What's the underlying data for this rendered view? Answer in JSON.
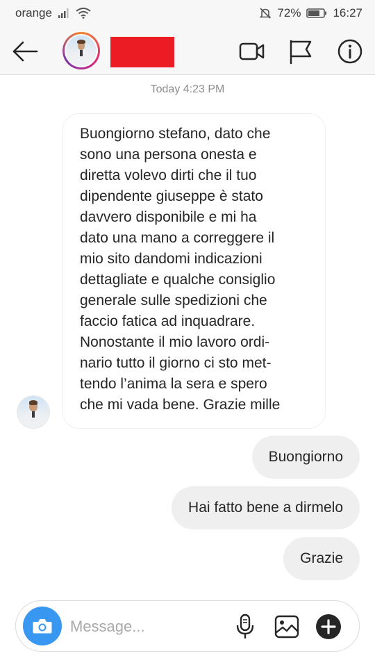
{
  "status_bar": {
    "carrier": "orange",
    "battery": "72%",
    "time": "16:27"
  },
  "header": {
    "back_icon": "arrow-left-icon",
    "video_icon": "video-camera-icon",
    "flag_icon": "flag-icon",
    "info_icon": "info-icon"
  },
  "chat": {
    "timestamp": "Today 4:23 PM",
    "incoming": {
      "lines": [
        "Buongiorno stefano, dato che",
        "sono una persona onesta e",
        "diretta volevo dirti che il tuo",
        "dipendente giuseppe è stato",
        "davvero disponibile e mi ha",
        "dato una mano a correggere il",
        "mio sito dandomi indicazioni",
        "dettagliate e qualche consiglio",
        "generale sulle spedizioni che",
        "faccio fatica ad inquadrare.",
        "Nonostante il mio lavoro ordi-",
        "nario tutto il giorno ci sto met-",
        "tendo l’anima la sera e spero",
        "che mi vada bene. Grazie mille"
      ]
    },
    "outgoing": [
      {
        "text": "Buongiorno"
      },
      {
        "text": "Hai fatto bene a dirmelo"
      },
      {
        "text": "Grazie"
      }
    ]
  },
  "composer": {
    "placeholder": "Message...",
    "accent_color": "#3897f0"
  }
}
